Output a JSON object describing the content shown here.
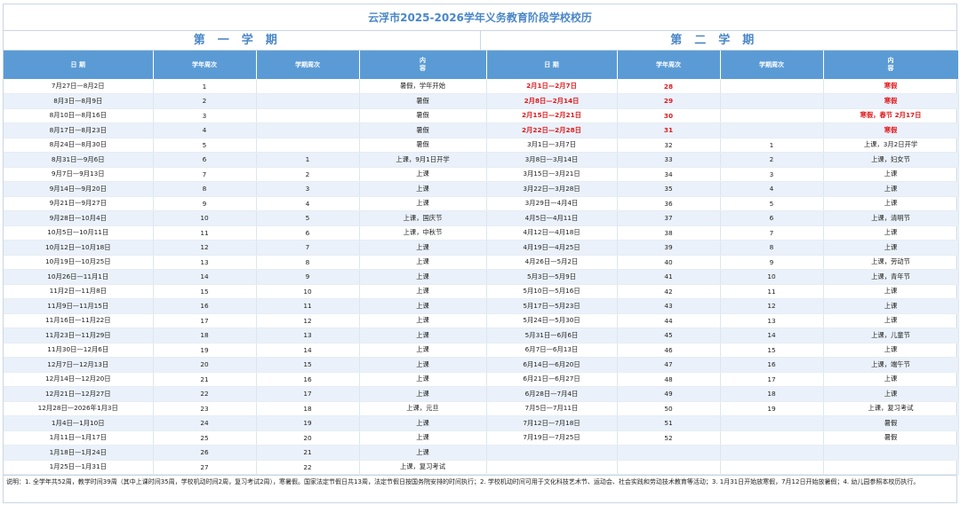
{
  "title": "云浮市2025-2026学年义务教育阶段学校校历",
  "term1_title": "第一学期",
  "term2_title": "第二学期",
  "headers": [
    "日 期",
    "学年周次",
    "学期周次",
    "内\n容",
    "日 期",
    "学年周次",
    "学期周次",
    "内\n容"
  ],
  "rows": [
    {
      "d1": "7月27日—8月2日",
      "y1": "1",
      "t1": "",
      "c1": "暑假，学年开始",
      "d2": "2月1日—2月7日",
      "y2": "28",
      "t2": "",
      "c2": "寒假",
      "red2": true
    },
    {
      "d1": "8月3日—8月9日",
      "y1": "2",
      "t1": "",
      "c1": "暑假",
      "d2": "2月8日—2月14日",
      "y2": "29",
      "t2": "",
      "c2": "寒假",
      "red2": true
    },
    {
      "d1": "8月10日—8月16日",
      "y1": "3",
      "t1": "",
      "c1": "暑假",
      "d2": "2月15日—2月21日",
      "y2": "30",
      "t2": "",
      "c2": "寒假，春节 2月17日",
      "red2": true
    },
    {
      "d1": "8月17日—8月23日",
      "y1": "4",
      "t1": "",
      "c1": "暑假",
      "d2": "2月22日—2月28日",
      "y2": "31",
      "t2": "",
      "c2": "寒假",
      "red2": true
    },
    {
      "d1": "8月24日—8月30日",
      "y1": "5",
      "t1": "",
      "c1": "暑假",
      "d2": "3月1日—3月7日",
      "y2": "32",
      "t2": "1",
      "c2": "上课，3月2日开学"
    },
    {
      "d1": "8月31日—9月6日",
      "y1": "6",
      "t1": "1",
      "c1": "上课，9月1日开学",
      "d2": "3月8日—3月14日",
      "y2": "33",
      "t2": "2",
      "c2": "上课，妇女节"
    },
    {
      "d1": "9月7日—9月13日",
      "y1": "7",
      "t1": "2",
      "c1": "上课",
      "d2": "3月15日—3月21日",
      "y2": "34",
      "t2": "3",
      "c2": "上课"
    },
    {
      "d1": "9月14日—9月20日",
      "y1": "8",
      "t1": "3",
      "c1": "上课",
      "d2": "3月22日—3月28日",
      "y2": "35",
      "t2": "4",
      "c2": "上课"
    },
    {
      "d1": "9月21日—9月27日",
      "y1": "9",
      "t1": "4",
      "c1": "上课",
      "d2": "3月29日—4月4日",
      "y2": "36",
      "t2": "5",
      "c2": "上课"
    },
    {
      "d1": "9月28日—10月4日",
      "y1": "10",
      "t1": "5",
      "c1": "上课，国庆节",
      "d2": "4月5日—4月11日",
      "y2": "37",
      "t2": "6",
      "c2": "上课，清明节"
    },
    {
      "d1": "10月5日—10月11日",
      "y1": "11",
      "t1": "6",
      "c1": "上课，中秋节",
      "d2": "4月12日—4月18日",
      "y2": "38",
      "t2": "7",
      "c2": "上课"
    },
    {
      "d1": "10月12日—10月18日",
      "y1": "12",
      "t1": "7",
      "c1": "上课",
      "d2": "4月19日—4月25日",
      "y2": "39",
      "t2": "8",
      "c2": "上课"
    },
    {
      "d1": "10月19日—10月25日",
      "y1": "13",
      "t1": "8",
      "c1": "上课",
      "d2": "4月26日—5月2日",
      "y2": "40",
      "t2": "9",
      "c2": "上课，劳动节"
    },
    {
      "d1": "10月26日—11月1日",
      "y1": "14",
      "t1": "9",
      "c1": "上课",
      "d2": "5月3日—5月9日",
      "y2": "41",
      "t2": "10",
      "c2": "上课，青年节"
    },
    {
      "d1": "11月2日—11月8日",
      "y1": "15",
      "t1": "10",
      "c1": "上课",
      "d2": "5月10日—5月16日",
      "y2": "42",
      "t2": "11",
      "c2": "上课"
    },
    {
      "d1": "11月9日—11月15日",
      "y1": "16",
      "t1": "11",
      "c1": "上课",
      "d2": "5月17日—5月23日",
      "y2": "43",
      "t2": "12",
      "c2": "上课"
    },
    {
      "d1": "11月16日—11月22日",
      "y1": "17",
      "t1": "12",
      "c1": "上课",
      "d2": "5月24日—5月30日",
      "y2": "44",
      "t2": "13",
      "c2": "上课"
    },
    {
      "d1": "11月23日—11月29日",
      "y1": "18",
      "t1": "13",
      "c1": "上课",
      "d2": "5月31日—6月6日",
      "y2": "45",
      "t2": "14",
      "c2": "上课，儿童节"
    },
    {
      "d1": "11月30日—12月6日",
      "y1": "19",
      "t1": "14",
      "c1": "上课",
      "d2": "6月7日—6月13日",
      "y2": "46",
      "t2": "15",
      "c2": "上课"
    },
    {
      "d1": "12月7日—12月13日",
      "y1": "20",
      "t1": "15",
      "c1": "上课",
      "d2": "6月14日—6月20日",
      "y2": "47",
      "t2": "16",
      "c2": "上课，端午节"
    },
    {
      "d1": "12月14日—12月20日",
      "y1": "21",
      "t1": "16",
      "c1": "上课",
      "d2": "6月21日—6月27日",
      "y2": "48",
      "t2": "17",
      "c2": "上课"
    },
    {
      "d1": "12月21日—12月27日",
      "y1": "22",
      "t1": "17",
      "c1": "上课",
      "d2": "6月28日—7月4日",
      "y2": "49",
      "t2": "18",
      "c2": "上课"
    },
    {
      "d1": "12月28日—2026年1月3日",
      "y1": "23",
      "t1": "18",
      "c1": "上课，元旦",
      "d2": "7月5日—7月11日",
      "y2": "50",
      "t2": "19",
      "c2": "上课，复习考试"
    },
    {
      "d1": "1月4日—1月10日",
      "y1": "24",
      "t1": "19",
      "c1": "上课",
      "d2": "7月12日—7月18日",
      "y2": "51",
      "t2": "",
      "c2": "暑假"
    },
    {
      "d1": "1月11日—1月17日",
      "y1": "25",
      "t1": "20",
      "c1": "上课",
      "d2": "7月19日—7月25日",
      "y2": "52",
      "t2": "",
      "c2": "暑假"
    },
    {
      "d1": "1月18日—1月24日",
      "y1": "26",
      "t1": "21",
      "c1": "上课",
      "d2": "",
      "y2": "",
      "t2": "",
      "c2": ""
    },
    {
      "d1": "1月25日—1月31日",
      "y1": "27",
      "t1": "22",
      "c1": "上课，复习考试",
      "d2": "",
      "y2": "",
      "t2": "",
      "c2": ""
    }
  ],
  "note": "说明：1. 全学年共52周，教学时间39周（其中上课时间35周，学校机动时间2周，复习考试2周），寒暑假。国家法定节假日共13周，法定节假日按国务院安排的时间执行；2. 学校机动时间可用于文化科技艺术节、运动会、社会实践和劳动技术教育等活动；3. 1月31日开始放寒假，7月12日开始放暑假；4. 幼儿园参照本校历执行。"
}
